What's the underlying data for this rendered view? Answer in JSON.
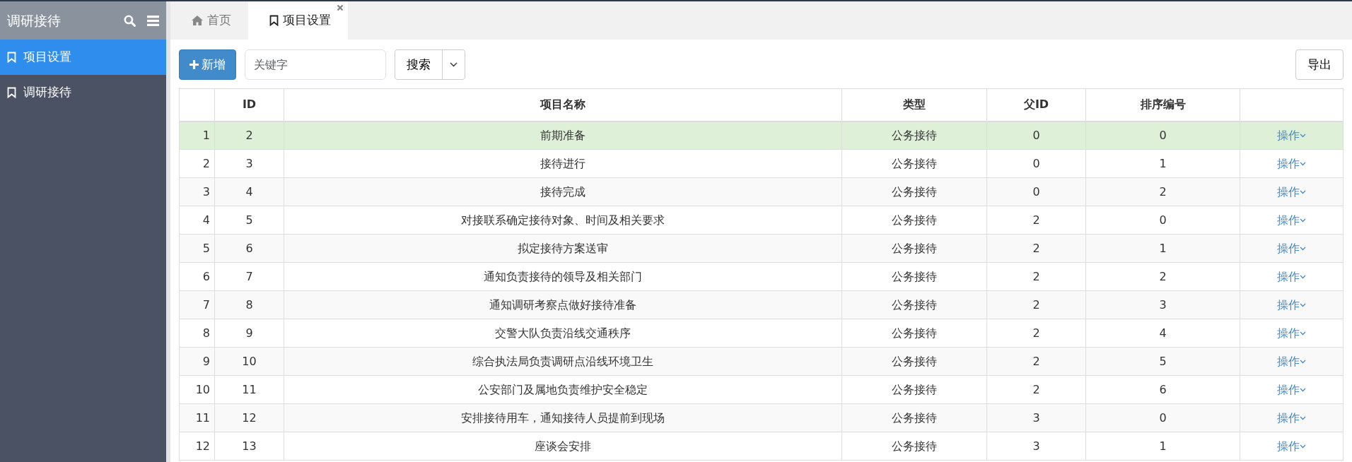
{
  "sidebar": {
    "title": "调研接待",
    "items": [
      {
        "label": "项目设置",
        "selected": true
      },
      {
        "label": "调研接待",
        "selected": false
      }
    ]
  },
  "tabs": [
    {
      "label": "首页",
      "kind": "home",
      "selected": false,
      "closable": false
    },
    {
      "label": "项目设置",
      "kind": "page",
      "selected": true,
      "closable": true
    }
  ],
  "toolbar": {
    "add_button": "新增",
    "search": {
      "placeholder": "关键字"
    },
    "search_button": "搜索",
    "export_button": "导出"
  },
  "table": {
    "columns": [
      "",
      "ID",
      "项目名称",
      "类型",
      "父ID",
      "排序编号",
      ""
    ],
    "rows": [
      {
        "cells": [
          "1",
          "2",
          "前期准备",
          "公务接待",
          "0",
          "0"
        ],
        "action": "操作",
        "selected": true
      },
      {
        "cells": [
          "2",
          "3",
          "接待进行",
          "公务接待",
          "0",
          "1"
        ],
        "action": "操作",
        "selected": false
      },
      {
        "cells": [
          "3",
          "4",
          "接待完成",
          "公务接待",
          "0",
          "2"
        ],
        "action": "操作",
        "selected": false
      },
      {
        "cells": [
          "4",
          "5",
          "对接联系确定接待对象、时间及相关要求",
          "公务接待",
          "2",
          "0"
        ],
        "action": "操作",
        "selected": false
      },
      {
        "cells": [
          "5",
          "6",
          "拟定接待方案送审",
          "公务接待",
          "2",
          "1"
        ],
        "action": "操作",
        "selected": false
      },
      {
        "cells": [
          "6",
          "7",
          "通知负责接待的领导及相关部门",
          "公务接待",
          "2",
          "2"
        ],
        "action": "操作",
        "selected": false
      },
      {
        "cells": [
          "7",
          "8",
          "通知调研考察点做好接待准备",
          "公务接待",
          "2",
          "3"
        ],
        "action": "操作",
        "selected": false
      },
      {
        "cells": [
          "8",
          "9",
          "交警大队负责沿线交通秩序",
          "公务接待",
          "2",
          "4"
        ],
        "action": "操作",
        "selected": false
      },
      {
        "cells": [
          "9",
          "10",
          "综合执法局负责调研点沿线环境卫生",
          "公务接待",
          "2",
          "5"
        ],
        "action": "操作",
        "selected": false
      },
      {
        "cells": [
          "10",
          "11",
          "公安部门及属地负责维护安全稳定",
          "公务接待",
          "2",
          "6"
        ],
        "action": "操作",
        "selected": false
      },
      {
        "cells": [
          "11",
          "12",
          "安排接待用车，通知接待人员提前到现场",
          "公务接待",
          "3",
          "0"
        ],
        "action": "操作",
        "selected": false
      },
      {
        "cells": [
          "12",
          "13",
          "座谈会安排",
          "公务接待",
          "3",
          "1"
        ],
        "action": "操作",
        "selected": false
      }
    ]
  }
}
